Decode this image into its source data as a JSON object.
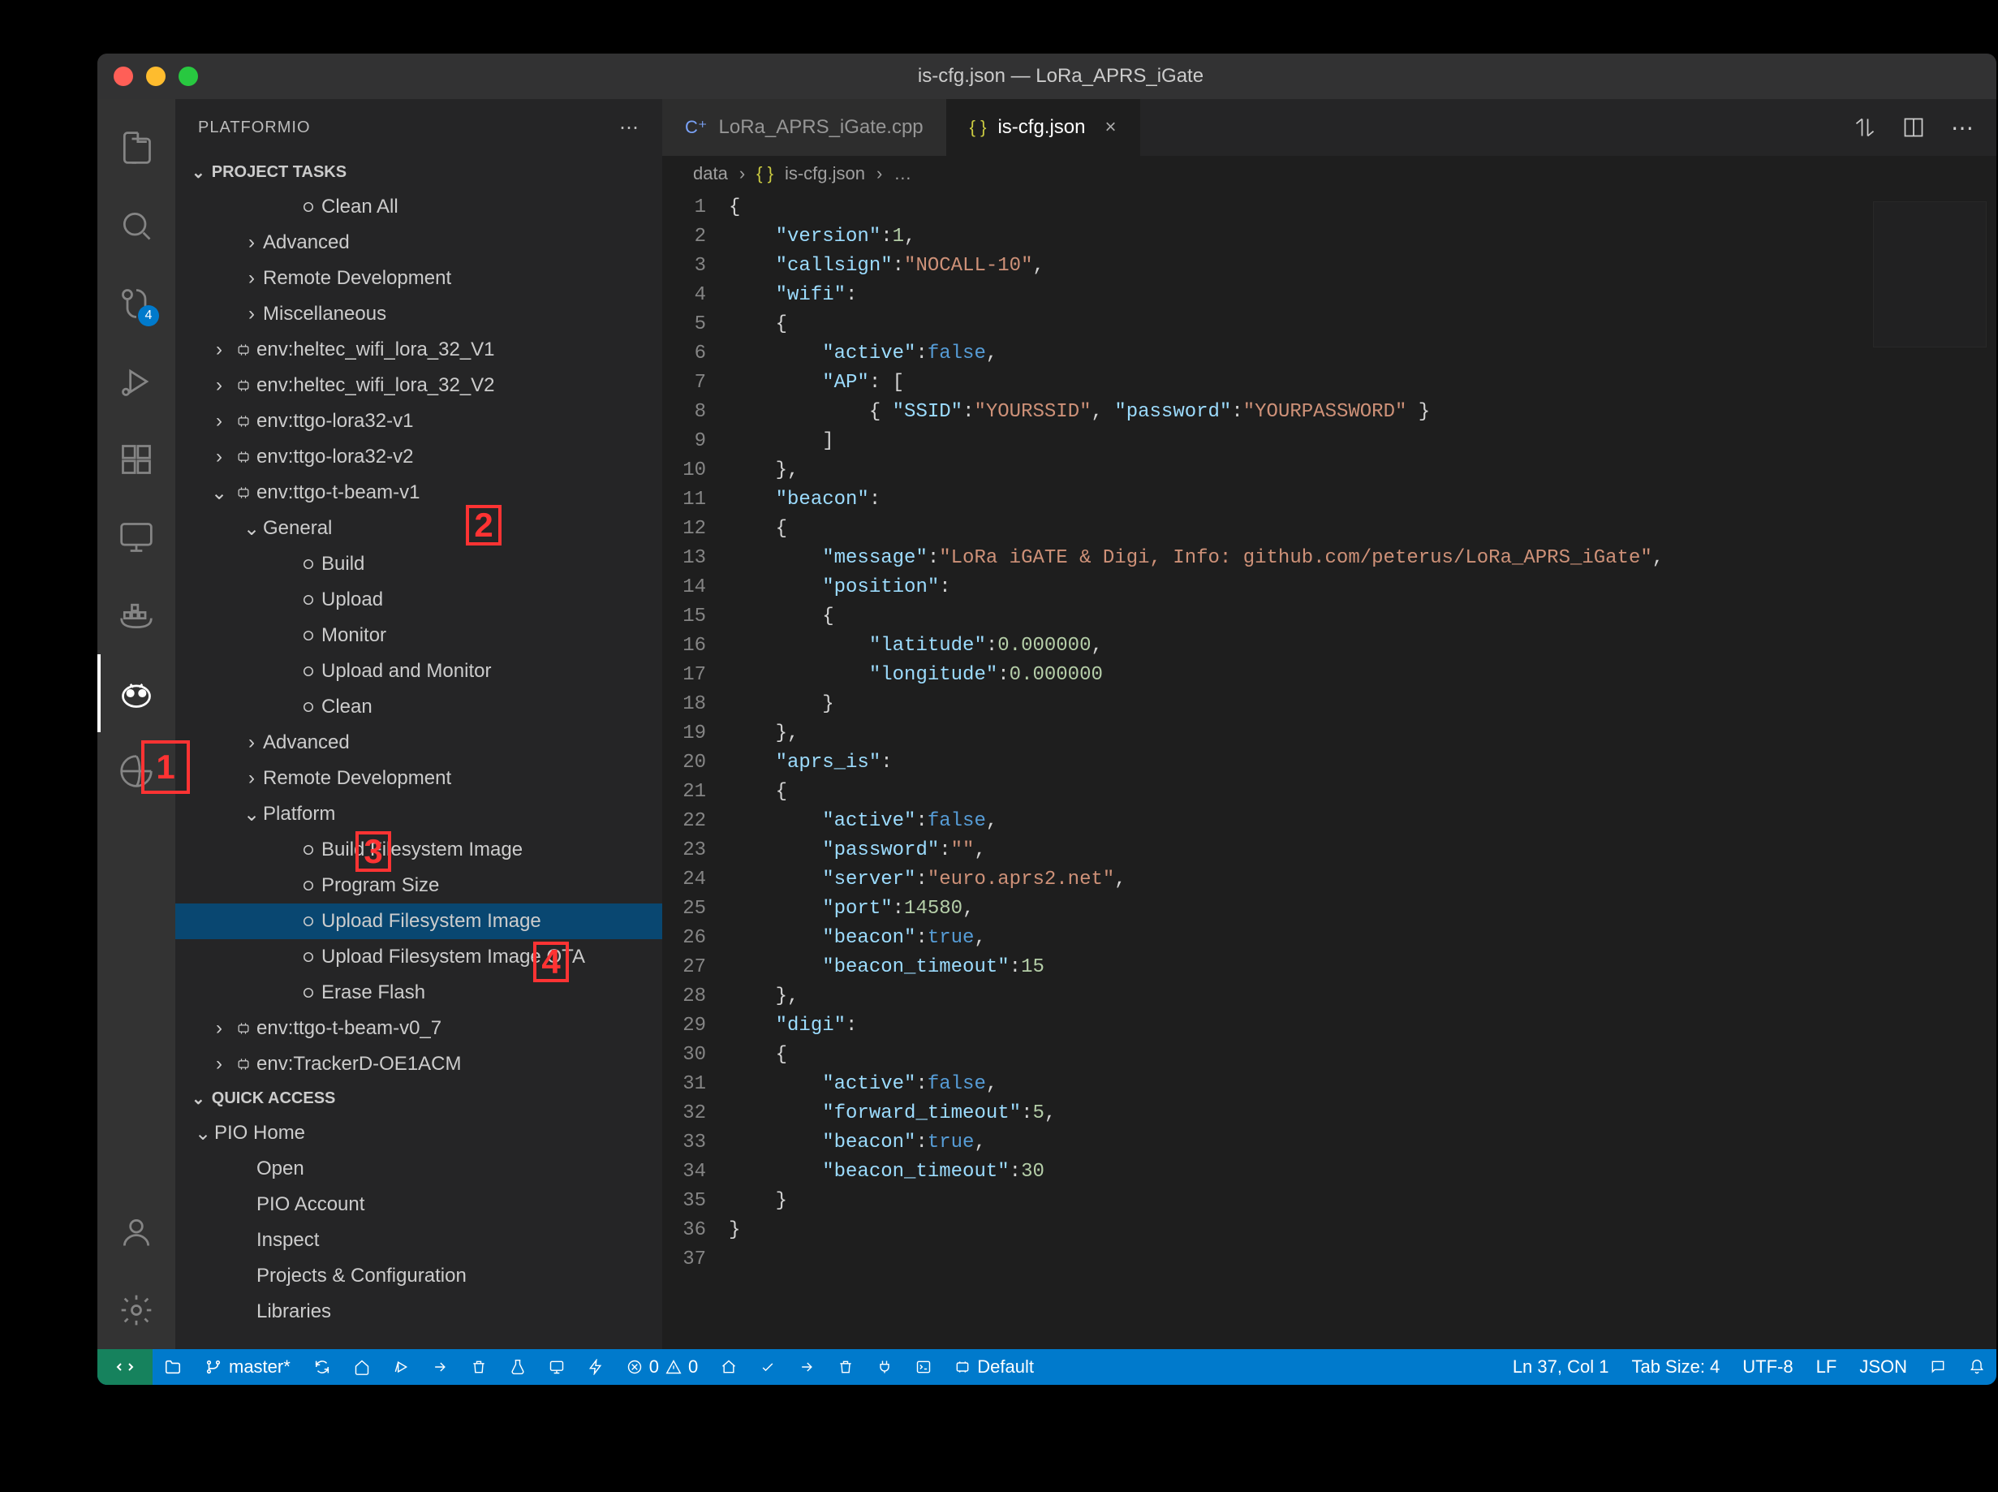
{
  "window_title": "is-cfg.json — LoRa_APRS_iGate",
  "activity_bar": {
    "badge_sc": "4"
  },
  "sidebar": {
    "header": "PLATFORMIO",
    "project_tasks_title": "PROJECT TASKS",
    "quick_access_title": "QUICK ACCESS",
    "pio_home": "PIO Home",
    "pt_rows": [
      {
        "label": "Clean All",
        "indent": 3,
        "icon": "hollow",
        "twisty": ""
      },
      {
        "label": "Advanced",
        "indent": 2,
        "icon": "",
        "twisty": ">"
      },
      {
        "label": "Remote Development",
        "indent": 2,
        "icon": "",
        "twisty": ">"
      },
      {
        "label": "Miscellaneous",
        "indent": 2,
        "icon": "",
        "twisty": ">"
      },
      {
        "label": "env:heltec_wifi_lora_32_V1",
        "indent": 1,
        "icon": "env",
        "twisty": ">"
      },
      {
        "label": "env:heltec_wifi_lora_32_V2",
        "indent": 1,
        "icon": "env",
        "twisty": ">"
      },
      {
        "label": "env:ttgo-lora32-v1",
        "indent": 1,
        "icon": "env",
        "twisty": ">"
      },
      {
        "label": "env:ttgo-lora32-v2",
        "indent": 1,
        "icon": "env",
        "twisty": ">"
      },
      {
        "label": "env:ttgo-t-beam-v1",
        "indent": 1,
        "icon": "env",
        "twisty": "v"
      },
      {
        "label": "General",
        "indent": 2,
        "icon": "",
        "twisty": "v"
      },
      {
        "label": "Build",
        "indent": 3,
        "icon": "hollow",
        "twisty": ""
      },
      {
        "label": "Upload",
        "indent": 3,
        "icon": "hollow",
        "twisty": ""
      },
      {
        "label": "Monitor",
        "indent": 3,
        "icon": "hollow",
        "twisty": ""
      },
      {
        "label": "Upload and Monitor",
        "indent": 3,
        "icon": "hollow",
        "twisty": ""
      },
      {
        "label": "Clean",
        "indent": 3,
        "icon": "hollow",
        "twisty": ""
      },
      {
        "label": "Advanced",
        "indent": 2,
        "icon": "",
        "twisty": ">"
      },
      {
        "label": "Remote Development",
        "indent": 2,
        "icon": "",
        "twisty": ">"
      },
      {
        "label": "Platform",
        "indent": 2,
        "icon": "",
        "twisty": "v"
      },
      {
        "label": "Build Filesystem Image",
        "indent": 3,
        "icon": "hollow",
        "twisty": ""
      },
      {
        "label": "Program Size",
        "indent": 3,
        "icon": "hollow",
        "twisty": ""
      },
      {
        "label": "Upload Filesystem Image",
        "indent": 3,
        "icon": "hollow",
        "twisty": "",
        "selected": true
      },
      {
        "label": "Upload Filesystem Image OTA",
        "indent": 3,
        "icon": "hollow",
        "twisty": ""
      },
      {
        "label": "Erase Flash",
        "indent": 3,
        "icon": "hollow",
        "twisty": ""
      },
      {
        "label": "env:ttgo-t-beam-v0_7",
        "indent": 1,
        "icon": "env",
        "twisty": ">"
      },
      {
        "label": "env:TrackerD-OE1ACM",
        "indent": 1,
        "icon": "env",
        "twisty": ">"
      }
    ],
    "qa_rows": [
      {
        "label": "Open"
      },
      {
        "label": "PIO Account"
      },
      {
        "label": "Inspect"
      },
      {
        "label": "Projects & Configuration"
      },
      {
        "label": "Libraries"
      }
    ]
  },
  "tabs": {
    "t0_label": "LoRa_APRS_iGate.cpp",
    "t1_label": "is-cfg.json"
  },
  "breadcrumbs": {
    "p0": "data",
    "p1": "is-cfg.json",
    "p2": "…"
  },
  "code": {
    "lines": [
      [
        [
          "punc",
          "{"
        ]
      ],
      [
        [
          "punc",
          "    "
        ],
        [
          "key",
          "\"version\""
        ],
        [
          "punc",
          ":"
        ],
        [
          "num",
          "1"
        ],
        [
          "punc",
          ","
        ]
      ],
      [
        [
          "punc",
          "    "
        ],
        [
          "key",
          "\"callsign\""
        ],
        [
          "punc",
          ":"
        ],
        [
          "str",
          "\"NOCALL-10\""
        ],
        [
          "punc",
          ","
        ]
      ],
      [
        [
          "punc",
          "    "
        ],
        [
          "key",
          "\"wifi\""
        ],
        [
          "punc",
          ":"
        ]
      ],
      [
        [
          "punc",
          "    {"
        ]
      ],
      [
        [
          "punc",
          "        "
        ],
        [
          "key",
          "\"active\""
        ],
        [
          "punc",
          ":"
        ],
        [
          "bool",
          "false"
        ],
        [
          "punc",
          ","
        ]
      ],
      [
        [
          "punc",
          "        "
        ],
        [
          "key",
          "\"AP\""
        ],
        [
          "punc",
          ": ["
        ]
      ],
      [
        [
          "punc",
          "            { "
        ],
        [
          "key",
          "\"SSID\""
        ],
        [
          "punc",
          ":"
        ],
        [
          "str",
          "\"YOURSSID\""
        ],
        [
          "punc",
          ", "
        ],
        [
          "key",
          "\"password\""
        ],
        [
          "punc",
          ":"
        ],
        [
          "str",
          "\"YOURPASSWORD\""
        ],
        [
          "punc",
          " }"
        ]
      ],
      [
        [
          "punc",
          "        ]"
        ]
      ],
      [
        [
          "punc",
          "    },"
        ]
      ],
      [
        [
          "punc",
          "    "
        ],
        [
          "key",
          "\"beacon\""
        ],
        [
          "punc",
          ":"
        ]
      ],
      [
        [
          "punc",
          "    {"
        ]
      ],
      [
        [
          "punc",
          "        "
        ],
        [
          "key",
          "\"message\""
        ],
        [
          "punc",
          ":"
        ],
        [
          "str",
          "\"LoRa iGATE & Digi, Info: github.com/peterus/LoRa_APRS_iGate\""
        ],
        [
          "punc",
          ","
        ]
      ],
      [
        [
          "punc",
          "        "
        ],
        [
          "key",
          "\"position\""
        ],
        [
          "punc",
          ":"
        ]
      ],
      [
        [
          "punc",
          "        {"
        ]
      ],
      [
        [
          "punc",
          "            "
        ],
        [
          "key",
          "\"latitude\""
        ],
        [
          "punc",
          ":"
        ],
        [
          "num",
          "0.000000"
        ],
        [
          "punc",
          ","
        ]
      ],
      [
        [
          "punc",
          "            "
        ],
        [
          "key",
          "\"longitude\""
        ],
        [
          "punc",
          ":"
        ],
        [
          "num",
          "0.000000"
        ]
      ],
      [
        [
          "punc",
          "        }"
        ]
      ],
      [
        [
          "punc",
          "    },"
        ]
      ],
      [
        [
          "punc",
          "    "
        ],
        [
          "key",
          "\"aprs_is\""
        ],
        [
          "punc",
          ":"
        ]
      ],
      [
        [
          "punc",
          "    {"
        ]
      ],
      [
        [
          "punc",
          "        "
        ],
        [
          "key",
          "\"active\""
        ],
        [
          "punc",
          ":"
        ],
        [
          "bool",
          "false"
        ],
        [
          "punc",
          ","
        ]
      ],
      [
        [
          "punc",
          "        "
        ],
        [
          "key",
          "\"password\""
        ],
        [
          "punc",
          ":"
        ],
        [
          "str",
          "\"\""
        ],
        [
          "punc",
          ","
        ]
      ],
      [
        [
          "punc",
          "        "
        ],
        [
          "key",
          "\"server\""
        ],
        [
          "punc",
          ":"
        ],
        [
          "str",
          "\"euro.aprs2.net\""
        ],
        [
          "punc",
          ","
        ]
      ],
      [
        [
          "punc",
          "        "
        ],
        [
          "key",
          "\"port\""
        ],
        [
          "punc",
          ":"
        ],
        [
          "num",
          "14580"
        ],
        [
          "punc",
          ","
        ]
      ],
      [
        [
          "punc",
          "        "
        ],
        [
          "key",
          "\"beacon\""
        ],
        [
          "punc",
          ":"
        ],
        [
          "bool",
          "true"
        ],
        [
          "punc",
          ","
        ]
      ],
      [
        [
          "punc",
          "        "
        ],
        [
          "key",
          "\"beacon_timeout\""
        ],
        [
          "punc",
          ":"
        ],
        [
          "num",
          "15"
        ]
      ],
      [
        [
          "punc",
          "    },"
        ]
      ],
      [
        [
          "punc",
          "    "
        ],
        [
          "key",
          "\"digi\""
        ],
        [
          "punc",
          ":"
        ]
      ],
      [
        [
          "punc",
          "    {"
        ]
      ],
      [
        [
          "punc",
          "        "
        ],
        [
          "key",
          "\"active\""
        ],
        [
          "punc",
          ":"
        ],
        [
          "bool",
          "false"
        ],
        [
          "punc",
          ","
        ]
      ],
      [
        [
          "punc",
          "        "
        ],
        [
          "key",
          "\"forward_timeout\""
        ],
        [
          "punc",
          ":"
        ],
        [
          "num",
          "5"
        ],
        [
          "punc",
          ","
        ]
      ],
      [
        [
          "punc",
          "        "
        ],
        [
          "key",
          "\"beacon\""
        ],
        [
          "punc",
          ":"
        ],
        [
          "bool",
          "true"
        ],
        [
          "punc",
          ","
        ]
      ],
      [
        [
          "punc",
          "        "
        ],
        [
          "key",
          "\"beacon_timeout\""
        ],
        [
          "punc",
          ":"
        ],
        [
          "num",
          "30"
        ]
      ],
      [
        [
          "punc",
          "    }"
        ]
      ],
      [
        [
          "punc",
          "}"
        ]
      ],
      [
        [
          "punc",
          ""
        ]
      ]
    ]
  },
  "statusbar": {
    "branch": "master*",
    "default_env": "Default",
    "err": "0",
    "warn": "0",
    "ln_col": "Ln 37, Col 1",
    "tab": "Tab Size: 4",
    "enc": "UTF-8",
    "eol": "LF",
    "lang": "JSON"
  },
  "annotations": {
    "a1": "1",
    "a2": "2",
    "a3": "3",
    "a4": "4"
  }
}
